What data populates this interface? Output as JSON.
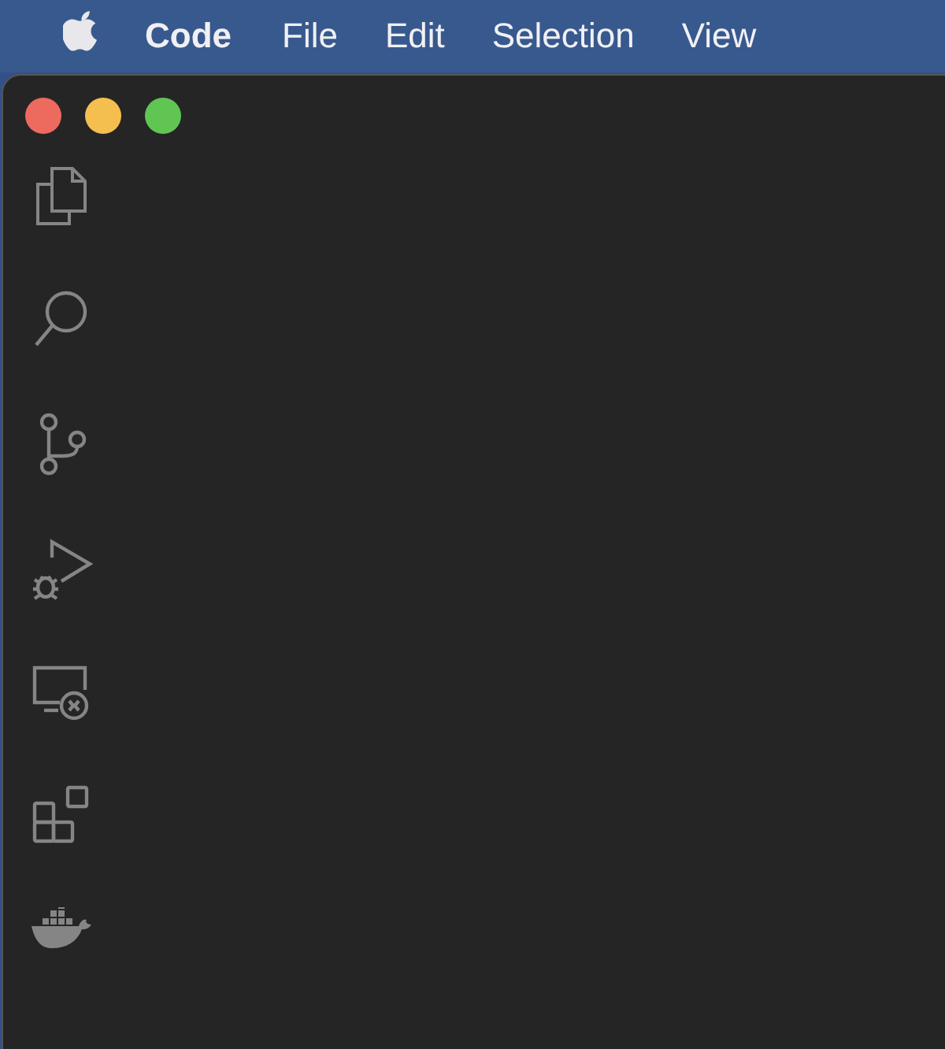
{
  "menu_bar": {
    "app_name": "Code",
    "menus": [
      "File",
      "Edit",
      "Selection",
      "View"
    ]
  }
}
